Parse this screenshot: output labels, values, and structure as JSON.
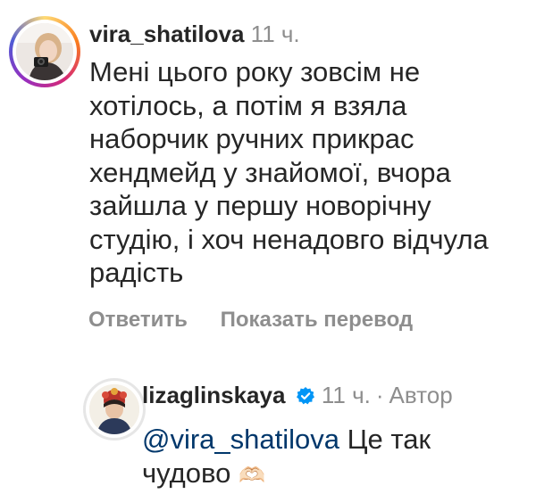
{
  "comment": {
    "username": "vira_shatilova",
    "time": "11 ч.",
    "lines": [
      "Мені цього року зовсім не",
      "хотілось, а потім я взяла",
      "наборчик ручних прикрас",
      "хендмейд у знайомої, вчора",
      "зайшла у першу новорічну",
      "студію, і хоч ненадовго відчула",
      "радість"
    ],
    "reply_label": "Ответить",
    "translate_label": "Показать перевод"
  },
  "reply": {
    "username": "lizaglinskaya",
    "time": "11 ч.",
    "separator": "·",
    "author_label": "Автор",
    "mention": "@vira_shatilova",
    "text_line1": " Це так",
    "text_line2": "чудово",
    "emoji": "🫶🏻"
  },
  "colors": {
    "text": "#262626",
    "secondary": "#8e8e8e",
    "mention": "#00376b",
    "verified": "#0095f6"
  }
}
